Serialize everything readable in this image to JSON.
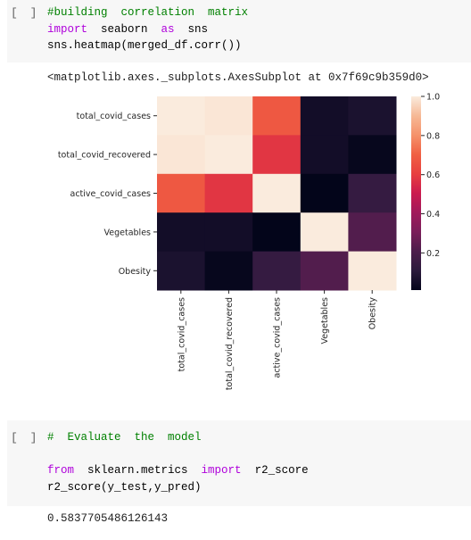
{
  "cells": [
    {
      "run_label": "[ ]",
      "code_lines": [
        [
          {
            "t": "#building  correlation  matrix",
            "c": "cm"
          }
        ],
        [
          {
            "t": "import",
            "c": "kw"
          },
          {
            "t": "  seaborn  ",
            "c": ""
          },
          {
            "t": "as",
            "c": "kw"
          },
          {
            "t": "  sns",
            "c": ""
          }
        ],
        [
          {
            "t": "sns.heatmap(merged_df.corr())",
            "c": ""
          }
        ]
      ],
      "output_text": "<matplotlib.axes._subplots.AxesSubplot at 0x7f69c9b359d0>"
    },
    {
      "run_label": "[ ]",
      "code_lines": [
        [
          {
            "t": "#  Evaluate  the  model",
            "c": "cm"
          }
        ],
        [
          {
            "t": "",
            "c": ""
          }
        ],
        [
          {
            "t": "from",
            "c": "kw"
          },
          {
            "t": "  sklearn.metrics  ",
            "c": ""
          },
          {
            "t": "import",
            "c": "kw"
          },
          {
            "t": "  r2_score",
            "c": ""
          }
        ],
        [
          {
            "t": "r2_score(y_test,y_pred)",
            "c": ""
          }
        ]
      ],
      "output_text": "0.5837705486126143"
    }
  ],
  "chart_data": {
    "type": "heatmap",
    "title": "",
    "xlabel": "",
    "ylabel": "",
    "row_labels": [
      "total_covid_cases",
      "total_covid_recovered",
      "active_covid_cases",
      "Vegetables",
      "Obesity"
    ],
    "col_labels": [
      "total_covid_cases",
      "total_covid_recovered",
      "active_covid_cases",
      "Vegetables",
      "Obesity"
    ],
    "values": [
      [
        1.0,
        0.99,
        0.68,
        0.05,
        0.07
      ],
      [
        0.99,
        1.0,
        0.58,
        0.05,
        0.02
      ],
      [
        0.68,
        0.58,
        1.0,
        0.01,
        0.14
      ],
      [
        0.05,
        0.05,
        0.01,
        1.0,
        0.22
      ],
      [
        0.07,
        0.02,
        0.14,
        0.22,
        1.0
      ]
    ],
    "colormap": "rocket",
    "colorbar": {
      "vmin": 0.01,
      "vmax": 1.0,
      "ticks": [
        0.2,
        0.4,
        0.6,
        0.8,
        1.0
      ],
      "tick_labels": [
        "0.2",
        "0.4",
        "0.6",
        "0.8",
        "1.0"
      ],
      "placement": "right"
    },
    "colormap_stops": [
      "#03051a",
      "#2b1a3c",
      "#4c1d4b",
      "#7a1e5a",
      "#a11a5b",
      "#cb1b4f",
      "#e83f3f",
      "#f06043",
      "#f5926b",
      "#f6b996",
      "#faebdd"
    ]
  }
}
